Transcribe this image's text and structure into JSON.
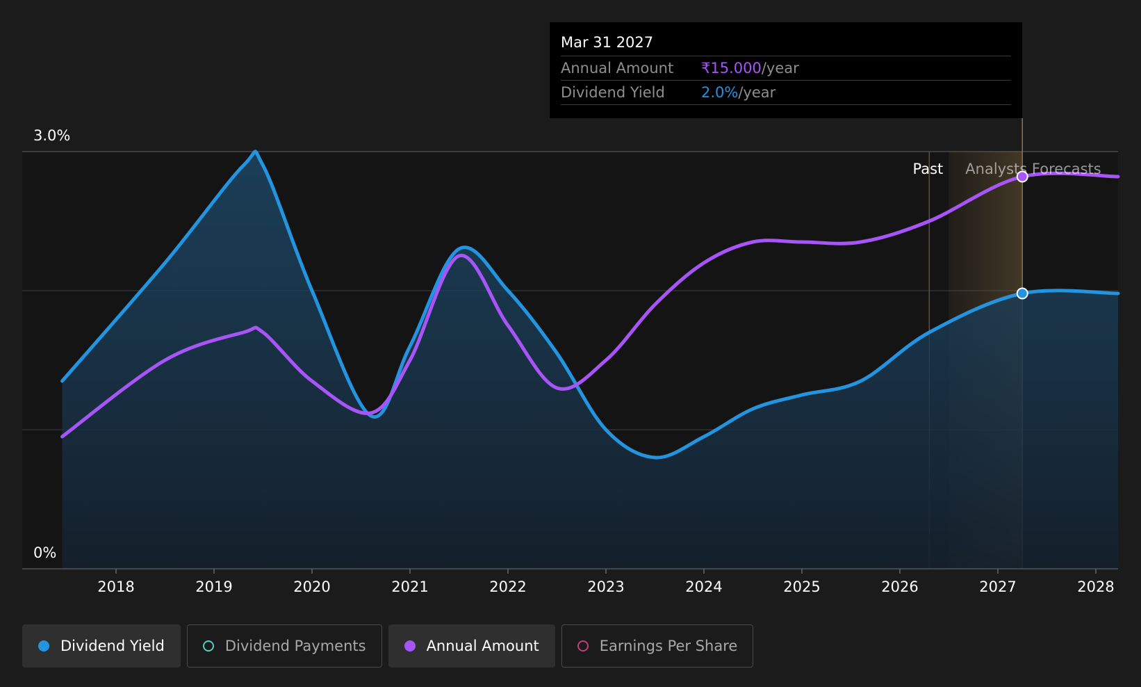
{
  "chart_data": {
    "type": "line",
    "x_axis": {
      "ticks": [
        "2018",
        "2019",
        "2020",
        "2021",
        "2022",
        "2023",
        "2024",
        "2025",
        "2026",
        "2027",
        "2028"
      ],
      "range": [
        2017.0,
        2028.2
      ]
    },
    "y_axis": {
      "top_label": "3.0%",
      "bottom_label": "0%",
      "range": [
        0,
        3.0
      ],
      "unit": "%"
    },
    "grid": true,
    "series": [
      {
        "name": "Dividend Yield",
        "color": "#2394df",
        "filled": true,
        "points": [
          [
            2017.45,
            1.35
          ],
          [
            2018.5,
            2.2
          ],
          [
            2019.3,
            2.9
          ],
          [
            2019.5,
            2.9
          ],
          [
            2020.0,
            2.0
          ],
          [
            2020.6,
            1.1
          ],
          [
            2021.0,
            1.6
          ],
          [
            2021.5,
            2.3
          ],
          [
            2022.0,
            2.0
          ],
          [
            2022.5,
            1.55
          ],
          [
            2023.0,
            1.0
          ],
          [
            2023.5,
            0.8
          ],
          [
            2024.0,
            0.95
          ],
          [
            2024.5,
            1.15
          ],
          [
            2025.0,
            1.25
          ],
          [
            2025.6,
            1.35
          ],
          [
            2026.3,
            1.7
          ],
          [
            2027.25,
            1.98
          ],
          [
            2028.25,
            1.98
          ]
        ]
      },
      {
        "name": "Annual Amount",
        "color": "#a855f7",
        "filled": false,
        "points": [
          [
            2017.45,
            0.95
          ],
          [
            2018.5,
            1.5
          ],
          [
            2019.3,
            1.7
          ],
          [
            2019.5,
            1.7
          ],
          [
            2020.0,
            1.35
          ],
          [
            2020.6,
            1.12
          ],
          [
            2021.0,
            1.5
          ],
          [
            2021.5,
            2.25
          ],
          [
            2022.0,
            1.75
          ],
          [
            2022.5,
            1.3
          ],
          [
            2023.0,
            1.5
          ],
          [
            2023.5,
            1.9
          ],
          [
            2024.0,
            2.2
          ],
          [
            2024.5,
            2.35
          ],
          [
            2025.0,
            2.35
          ],
          [
            2025.6,
            2.35
          ],
          [
            2026.3,
            2.5
          ],
          [
            2027.25,
            2.82
          ],
          [
            2028.25,
            2.82
          ]
        ]
      }
    ],
    "past_label": "Past",
    "forecast_label": "Analysts Forecasts",
    "tooltip": {
      "date": "Mar 31 2027",
      "rows": [
        {
          "label": "Annual Amount",
          "value": "₹15.000",
          "unit": "/year",
          "color": "#a855f7"
        },
        {
          "label": "Dividend Yield",
          "value": "2.0%",
          "unit": "/year",
          "color": "#2394df"
        }
      ]
    }
  },
  "legend": [
    {
      "label": "Dividend Yield",
      "active": true,
      "dot_color": "#2394df",
      "filled": true
    },
    {
      "label": "Dividend Payments",
      "active": false,
      "dot_color": "#4fd1c5",
      "filled": false
    },
    {
      "label": "Annual Amount",
      "active": true,
      "dot_color": "#a855f7",
      "filled": true
    },
    {
      "label": "Earnings Per Share",
      "active": false,
      "dot_color": "#c0407a",
      "filled": false
    }
  ]
}
